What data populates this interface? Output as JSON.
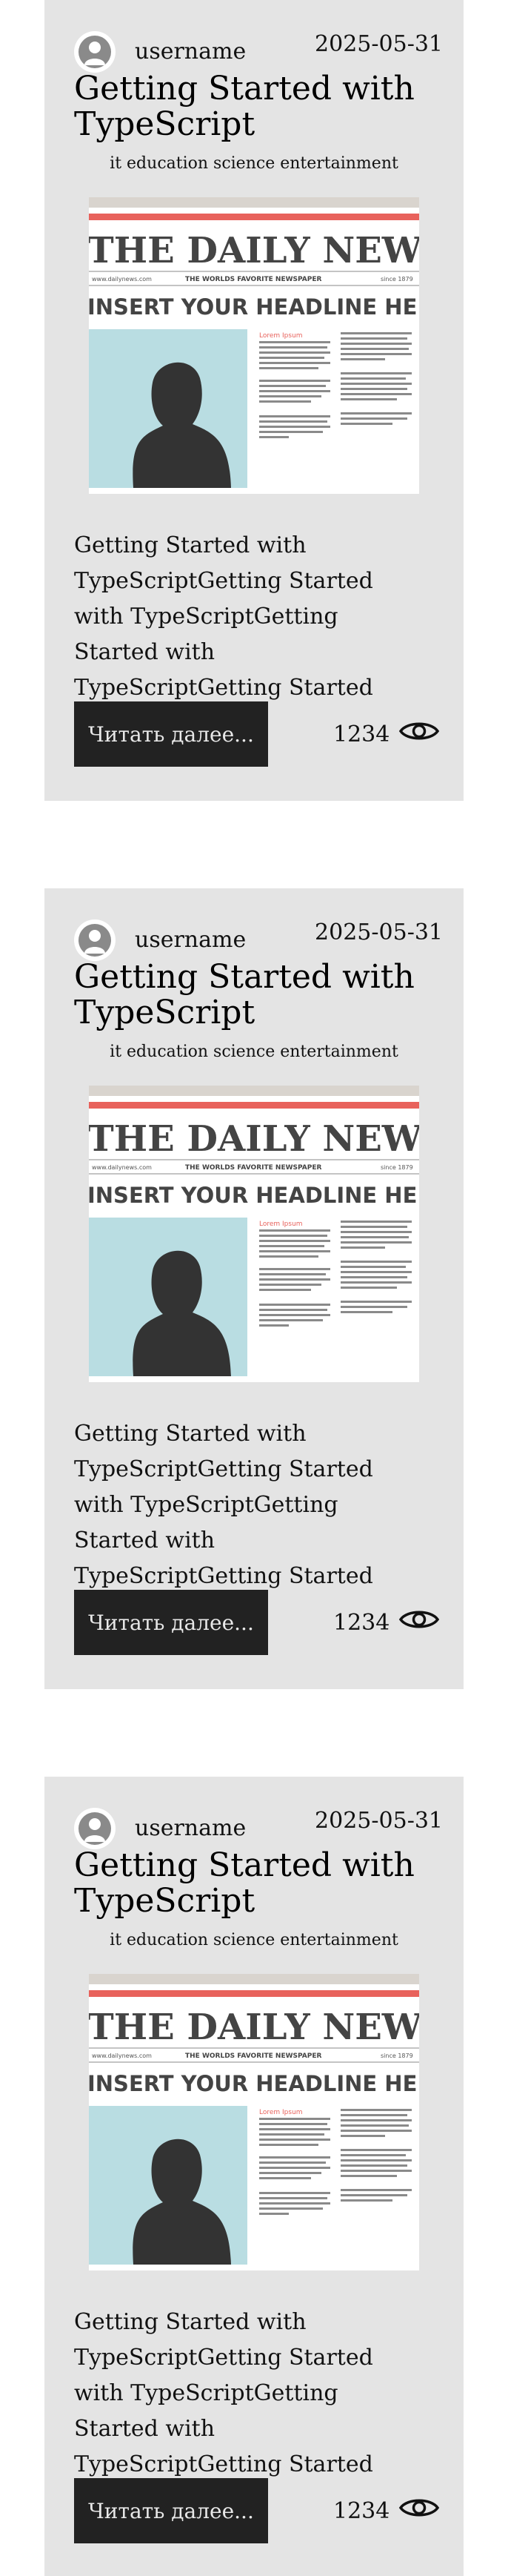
{
  "posts": [
    {
      "username": "username",
      "date": "2025-05-31",
      "title": "Getting Started with TypeScript",
      "tags": "it education science entertainment",
      "excerpt": "Getting Started with TypeScriptGetting Started with TypeScriptGetting Started with TypeScriptGetting Started with…",
      "read_more": "Читать далее...",
      "views": "1234",
      "image": {
        "masthead": "THE DAILY NEWS",
        "site": "www.dailynews.com",
        "tagline": "THE WORLDS FAVORITE NEWSPAPER",
        "since": "since 1879",
        "headline": "INSERT YOUR HEADLINE HERE",
        "lead": "Lorem Ipsum"
      }
    },
    {
      "username": "username",
      "date": "2025-05-31",
      "title": "Getting Started with TypeScript",
      "tags": "it education science entertainment",
      "excerpt": "Getting Started with TypeScriptGetting Started with TypeScriptGetting Started with TypeScriptGetting Started with…",
      "read_more": "Читать далее...",
      "views": "1234",
      "image": {
        "masthead": "THE DAILY NEWS",
        "site": "www.dailynews.com",
        "tagline": "THE WORLDS FAVORITE NEWSPAPER",
        "since": "since 1879",
        "headline": "INSERT YOUR HEADLINE HERE",
        "lead": "Lorem Ipsum"
      }
    },
    {
      "username": "username",
      "date": "2025-05-31",
      "title": "Getting Started with TypeScript",
      "tags": "it education science entertainment",
      "excerpt": "Getting Started with TypeScriptGetting Started with TypeScriptGetting Started with TypeScriptGetting Started with…",
      "read_more": "Читать далее...",
      "views": "1234",
      "image": {
        "masthead": "THE DAILY NEWS",
        "site": "www.dailynews.com",
        "tagline": "THE WORLDS FAVORITE NEWSPAPER",
        "since": "since 1879",
        "headline": "INSERT YOUR HEADLINE HERE",
        "lead": "Lorem Ipsum"
      }
    }
  ],
  "colors": {
    "card_bg": "#e4e4e4",
    "button_bg": "#222222",
    "masthead_red": "#e8625c",
    "photo_bg": "#b9dde2"
  },
  "icons": {
    "avatar": "user-icon",
    "views": "eye-icon"
  }
}
